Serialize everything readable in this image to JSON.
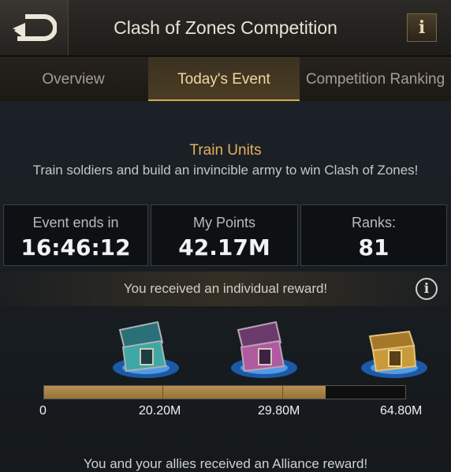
{
  "header": {
    "title": "Clash of Zones Competition",
    "back_icon": "back-arrow-icon",
    "info_label": "i"
  },
  "tabs": [
    {
      "label": "Overview",
      "active": false
    },
    {
      "label": "Today's Event",
      "active": true
    },
    {
      "label": "Competition Ranking",
      "active": false
    }
  ],
  "event": {
    "title": "Train Units",
    "description": "Train soldiers and build an invincible army to win Clash of Zones!"
  },
  "stats": [
    {
      "label": "Event ends in",
      "value": "16:46:12"
    },
    {
      "label": "My Points",
      "value": "42.17M"
    },
    {
      "label": "Ranks:",
      "value": "81"
    }
  ],
  "notice": {
    "text": "You received an individual reward!",
    "info_label": "i"
  },
  "rewards": {
    "chests": [
      {
        "name": "teal-chest",
        "color": "#3fa7a5",
        "state": "open"
      },
      {
        "name": "purple-chest",
        "color": "#b05aa0",
        "state": "open"
      },
      {
        "name": "gold-chest",
        "color": "#c99a3a",
        "state": "closed"
      }
    ],
    "milestones": [
      "0",
      "20.20M",
      "29.80M",
      "64.80M"
    ],
    "progress_value": "42.17M"
  },
  "footer": {
    "text": "You and your allies received an Alliance reward!"
  },
  "colors": {
    "accent_gold": "#d6a84d",
    "title_orange": "#e2b05c",
    "progress_fill": "#b8904e"
  }
}
